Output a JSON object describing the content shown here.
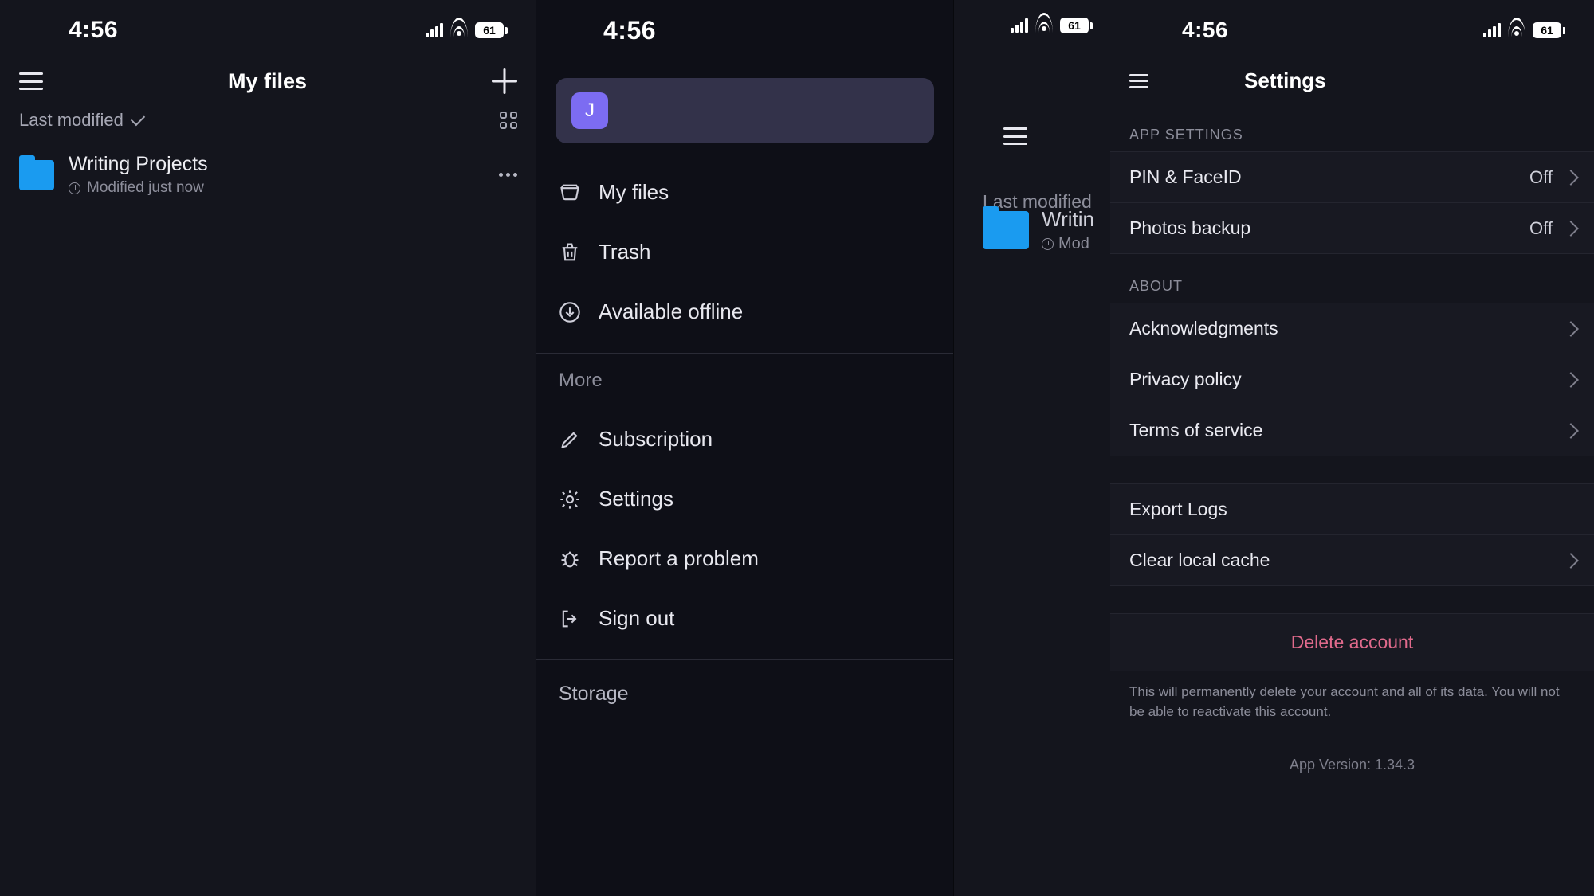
{
  "status": {
    "time": "4:56",
    "battery": "61"
  },
  "screenA": {
    "title": "My files",
    "sort": "Last modified",
    "file": {
      "name": "Writing Projects",
      "sub": "Modified just now"
    }
  },
  "drawer": {
    "avatar_initial": "J",
    "nav": [
      {
        "label": "My files"
      },
      {
        "label": "Trash"
      },
      {
        "label": "Available offline"
      }
    ],
    "more_label": "More",
    "more": [
      {
        "label": "Subscription"
      },
      {
        "label": "Settings"
      },
      {
        "label": "Report a problem"
      },
      {
        "label": "Sign out"
      }
    ],
    "storage_label": "Storage"
  },
  "peek": {
    "sort": "Last modified",
    "file_name_partial": "Writin",
    "file_sub_partial": "Mod"
  },
  "settings": {
    "title": "Settings",
    "app_settings_label": "APP SETTINGS",
    "rows_app": [
      {
        "label": "PIN & FaceID",
        "value": "Off"
      },
      {
        "label": "Photos backup",
        "value": "Off"
      }
    ],
    "about_label": "ABOUT",
    "rows_about": [
      {
        "label": "Acknowledgments"
      },
      {
        "label": "Privacy policy"
      },
      {
        "label": "Terms of service"
      }
    ],
    "rows_misc": [
      {
        "label": "Export Logs",
        "arrow": false
      },
      {
        "label": "Clear local cache",
        "arrow": true
      }
    ],
    "delete_label": "Delete account",
    "delete_note": "This will permanently delete your account and all of its data. You will not be able to reactivate this account.",
    "version": "App Version: 1.34.3"
  }
}
